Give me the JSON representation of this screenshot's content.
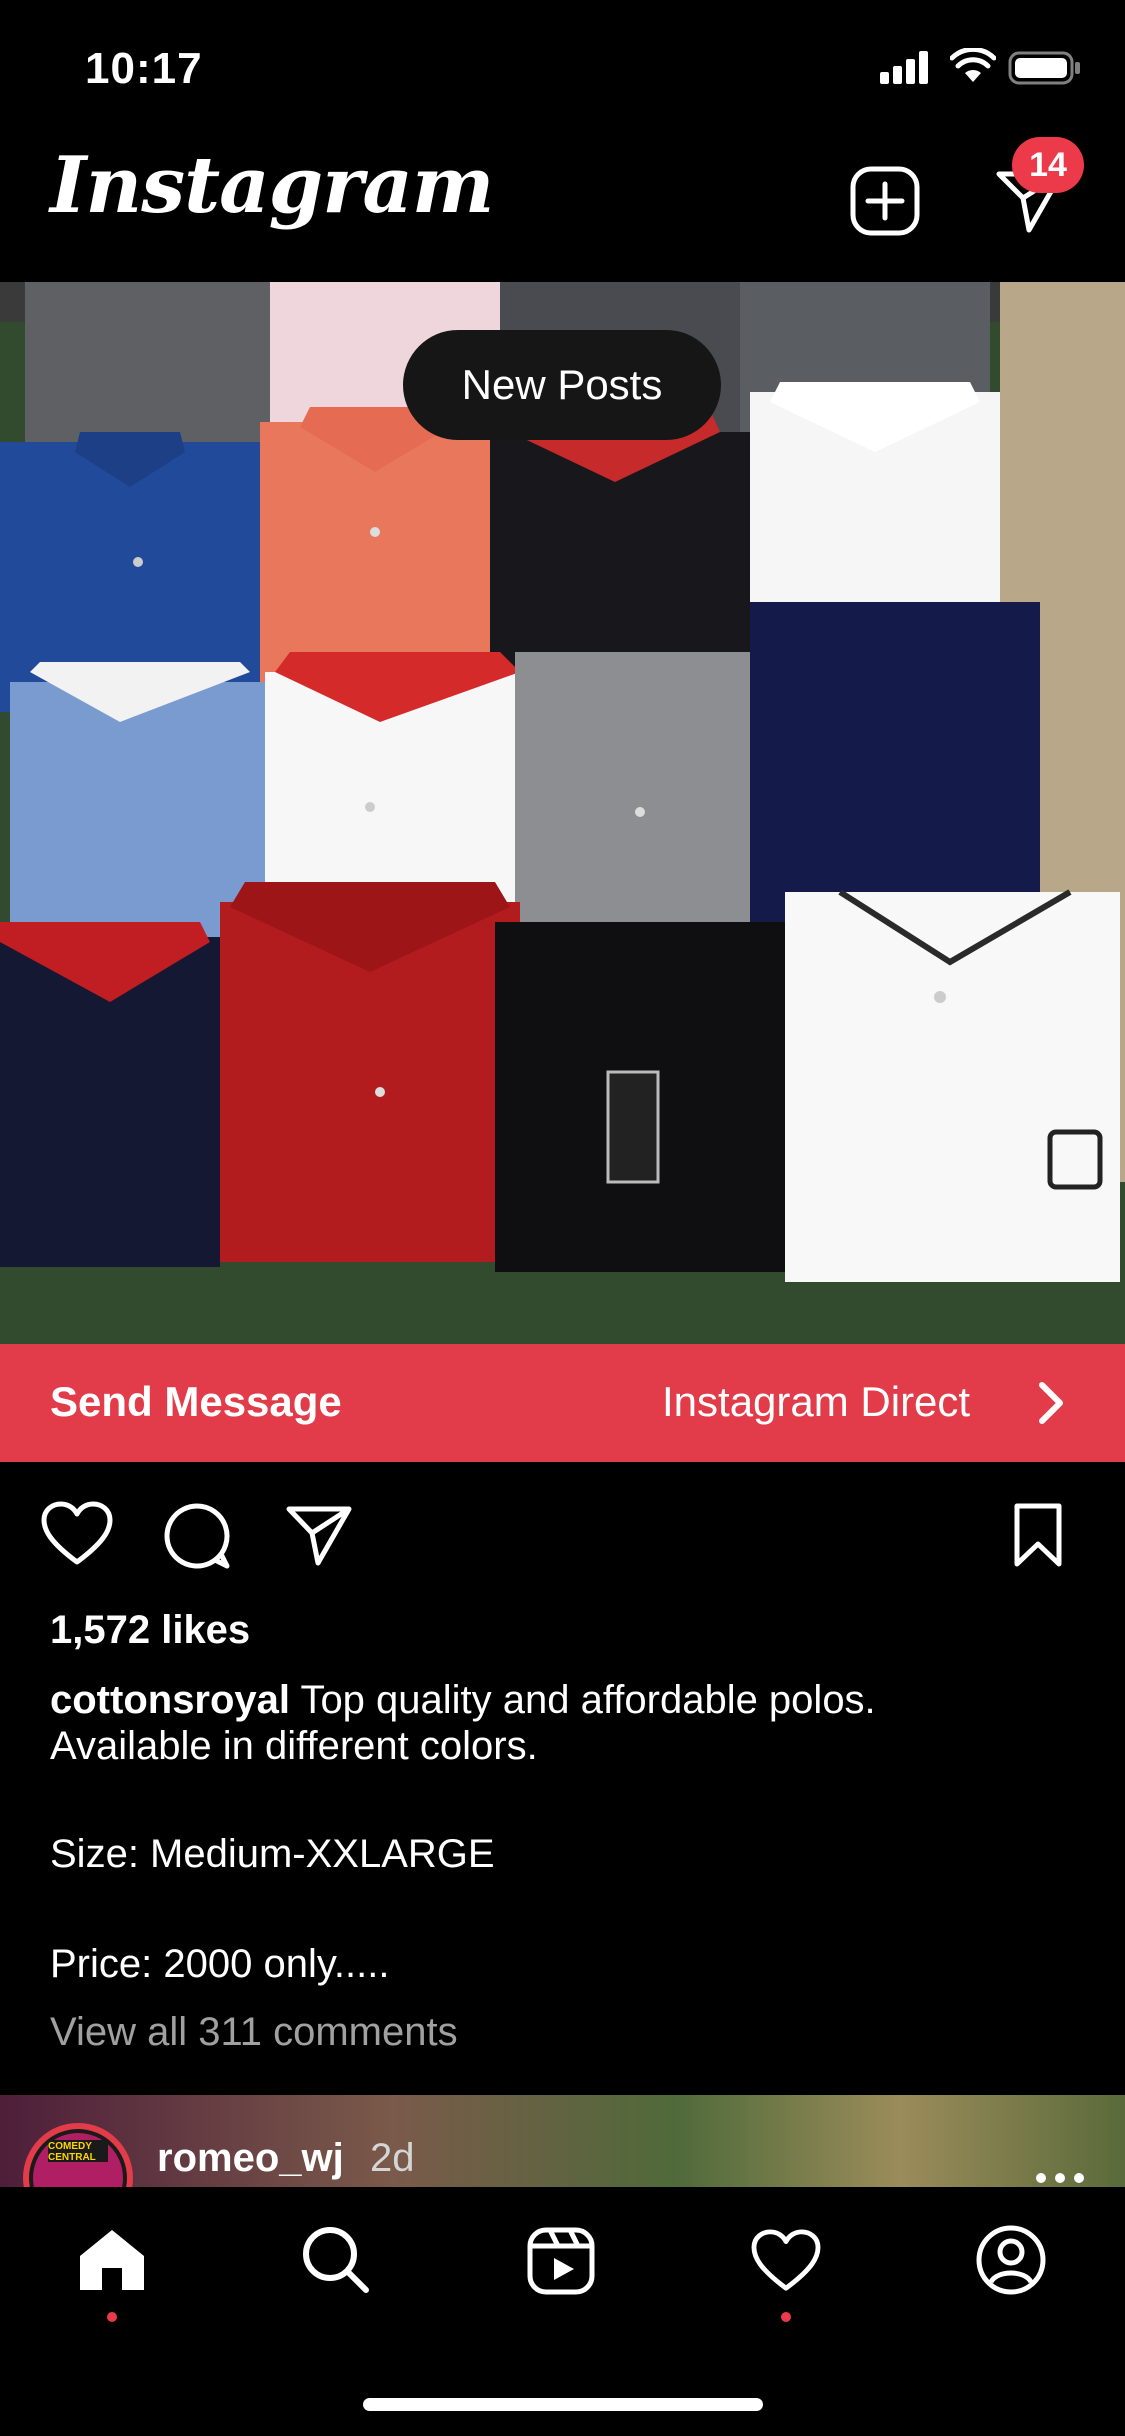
{
  "status_bar": {
    "time": "10:17"
  },
  "header": {
    "logo": "Instagram",
    "messages_badge": "14"
  },
  "post": {
    "new_posts_label": "New Posts",
    "cta_left": "Send Message",
    "cta_right": "Instagram Direct",
    "likes": "1,572 likes",
    "username": "cottonsroyal",
    "caption_lines": [
      "Top quality and affordable polos.",
      "Available in different colors.",
      "Size: Medium-XXLARGE",
      "Price: 2000 only....."
    ],
    "view_comments": "View all 311 comments"
  },
  "next_post": {
    "username": "romeo_wj",
    "time": "2d",
    "avatar_text": "COMEDY CENTRAL"
  },
  "tabs": [
    {
      "name": "home",
      "icon": "home-icon",
      "active": true
    },
    {
      "name": "search",
      "icon": "search-icon"
    },
    {
      "name": "reels",
      "icon": "reels-icon"
    },
    {
      "name": "activity",
      "icon": "heart-icon"
    },
    {
      "name": "profile",
      "icon": "profile-icon"
    }
  ],
  "colors": {
    "accent": "#e23c4a",
    "badge": "#ec3a4b",
    "background": "#000000"
  }
}
